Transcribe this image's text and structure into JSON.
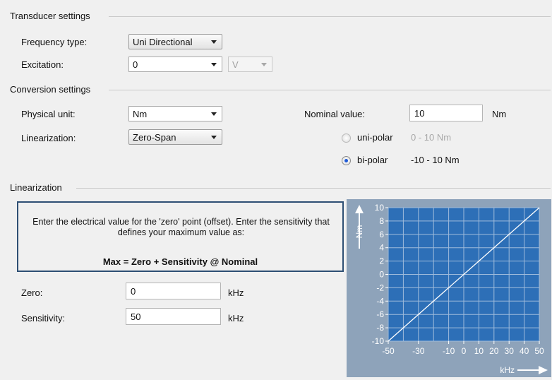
{
  "sections": {
    "transducer": "Transducer settings",
    "conversion": "Conversion settings",
    "linearization": "Linearization"
  },
  "transducer": {
    "frequency_type_label": "Frequency type:",
    "frequency_type_value": "Uni Directional",
    "excitation_label": "Excitation:",
    "excitation_value": "0",
    "excitation_unit": "V"
  },
  "conversion": {
    "physical_unit_label": "Physical unit:",
    "physical_unit_value": "Nm",
    "linearization_label": "Linearization:",
    "linearization_value": "Zero-Span",
    "nominal_label": "Nominal value:",
    "nominal_value": "10",
    "nominal_unit": "Nm",
    "unipolar_label": "uni-polar",
    "unipolar_range": "0 - 10 Nm",
    "unipolar_selected": false,
    "bipolar_label": "bi-polar",
    "bipolar_range": "-10 - 10 Nm",
    "bipolar_selected": true
  },
  "linearization": {
    "info_text": "Enter the electrical value for the 'zero' point (offset). Enter the sensitivity that defines your maximum value as:",
    "formula": "Max = Zero + Sensitivity @ Nominal",
    "zero_label": "Zero:",
    "zero_value": "0",
    "zero_unit": "kHz",
    "sensitivity_label": "Sensitivity:",
    "sensitivity_value": "50",
    "sensitivity_unit": "kHz"
  },
  "chart_data": {
    "type": "line",
    "xlabel": "kHz",
    "ylabel": "Nm",
    "xlim": [
      -50,
      50
    ],
    "ylim": [
      -10,
      10
    ],
    "x_ticks": [
      "-50",
      "-30",
      "-10",
      "0",
      "10",
      "20",
      "30",
      "40",
      "50"
    ],
    "x_tick_values": [
      -50,
      -30,
      -10,
      0,
      10,
      20,
      30,
      40,
      50
    ],
    "y_ticks": [
      "10",
      "8",
      "6",
      "4",
      "2",
      "0",
      "-2",
      "-4",
      "-6",
      "-8",
      "-10"
    ],
    "y_tick_values": [
      10,
      8,
      6,
      4,
      2,
      0,
      -2,
      -4,
      -6,
      -8,
      -10
    ],
    "grid": true,
    "series": [
      {
        "x": [
          -50,
          50
        ],
        "y": [
          -10,
          10
        ]
      }
    ],
    "colors": {
      "background": "#8ea3ba",
      "plot": "#2d6fb7",
      "grid": "#9fbbdb",
      "line": "#ffffff",
      "text": "#ffffff"
    }
  }
}
